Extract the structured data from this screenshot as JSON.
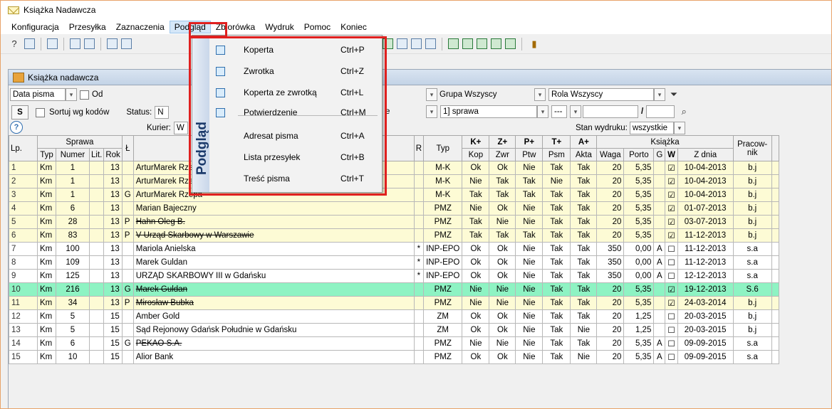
{
  "app": {
    "title": "Książka Nadawcza"
  },
  "menubar": [
    "Konfiguracja",
    "Przesyłka",
    "Zaznaczenia",
    "Podgląd",
    "Zbiorówka",
    "Wydruk",
    "Pomoc",
    "Koniec"
  ],
  "child_window": {
    "title": "Książka nadawcza"
  },
  "filters": {
    "date_field": "Data pisma",
    "od_label": "Od",
    "s_button": "S",
    "sort_label": "Sortuj wg kodów",
    "status_label": "Status:",
    "status_value": "N",
    "kurier_label": "Kurier:",
    "kurier_value": "W",
    "grupa": "Grupa  Wszyscy",
    "rola": "Rola  Wszyscy",
    "sprawa": "1] sprawa",
    "e_value": "e",
    "dash": "---",
    "slash": "/",
    "stan_label": "Stan wydruku:",
    "stan_value": "wszystkie"
  },
  "menu": {
    "side_label": "Podgląd",
    "items": [
      {
        "label": "Koperta",
        "shortcut": "Ctrl+P"
      },
      {
        "label": "Zwrotka",
        "shortcut": "Ctrl+Z"
      },
      {
        "label": "Koperta ze zwrotką",
        "shortcut": "Ctrl+L"
      },
      {
        "label": "Potwierdzenie",
        "shortcut": "Ctrl+M"
      },
      {
        "label": "Adresat pisma",
        "shortcut": "Ctrl+A"
      },
      {
        "label": "Lista przesyłek",
        "shortcut": "Ctrl+B"
      },
      {
        "label": "Treść pisma",
        "shortcut": "Ctrl+T"
      }
    ]
  },
  "grid": {
    "headers_top": {
      "lp": "Lp.",
      "sprawa": "Sprawa",
      "l": "Ł",
      "r": "R",
      "typ": "Typ",
      "k": "K+",
      "z": "Z+",
      "p": "P+",
      "t": "T+",
      "a": "A+",
      "ksiazka": "Książka",
      "prac1": "Pracow-",
      "prac2": "nik"
    },
    "headers_sub": {
      "typ": "Typ",
      "numer": "Numer",
      "lit": "Lit.",
      "rok": "Rok",
      "k": "Kop",
      "z": "Zwr",
      "p": "Ptw",
      "t": "Psm",
      "a": "Akta",
      "waga": "Waga",
      "porto": "Porto",
      "g": "G",
      "w": "W",
      "zdnia": "Z dnia"
    },
    "rows": [
      {
        "lp": "1",
        "typ": "Km",
        "numer": "1",
        "lit": "",
        "rok": "13",
        "l": "",
        "name": "ArturMarek Rzepa",
        "strike": false,
        "r": "",
        "typ2": "M-K",
        "k": "Ok",
        "z": "Ok",
        "p": "Nie",
        "t": "Tak",
        "a": "Tak",
        "waga": "20",
        "porto": "5,35",
        "g": "",
        "w": "☑",
        "zdnia": "10-04-2013",
        "prac": "b.j",
        "color": "y"
      },
      {
        "lp": "2",
        "typ": "Km",
        "numer": "1",
        "lit": "",
        "rok": "13",
        "l": "",
        "name": "ArturMarek Rzepa",
        "strike": false,
        "r": "",
        "typ2": "M-K",
        "k": "Nie",
        "z": "Tak",
        "p": "Tak",
        "t": "Nie",
        "a": "Tak",
        "waga": "20",
        "porto": "5,35",
        "g": "",
        "w": "☑",
        "zdnia": "10-04-2013",
        "prac": "b.j",
        "color": "y"
      },
      {
        "lp": "3",
        "typ": "Km",
        "numer": "1",
        "lit": "",
        "rok": "13",
        "l": "G",
        "name": "ArturMarek Rzepa",
        "strike": false,
        "r": "",
        "typ2": "M-K",
        "k": "Tak",
        "z": "Tak",
        "p": "Tak",
        "t": "Tak",
        "a": "Tak",
        "waga": "20",
        "porto": "5,35",
        "g": "",
        "w": "☑",
        "zdnia": "10-04-2013",
        "prac": "b.j",
        "color": "y"
      },
      {
        "lp": "4",
        "typ": "Km",
        "numer": "6",
        "lit": "",
        "rok": "13",
        "l": "",
        "name": "Marian Bajeczny",
        "strike": false,
        "r": "",
        "typ2": "PMZ",
        "k": "Nie",
        "z": "Ok",
        "p": "Nie",
        "t": "Tak",
        "a": "Tak",
        "waga": "20",
        "porto": "5,35",
        "g": "",
        "w": "☑",
        "zdnia": "01-07-2013",
        "prac": "b.j",
        "color": "y"
      },
      {
        "lp": "5",
        "typ": "Km",
        "numer": "28",
        "lit": "",
        "rok": "13",
        "l": "P",
        "name": "Hahn Oleg B.",
        "strike": true,
        "r": "",
        "typ2": "PMZ",
        "k": "Tak",
        "z": "Nie",
        "p": "Nie",
        "t": "Tak",
        "a": "Tak",
        "waga": "20",
        "porto": "5,35",
        "g": "",
        "w": "☑",
        "zdnia": "03-07-2013",
        "prac": "b.j",
        "color": "y"
      },
      {
        "lp": "6",
        "typ": "Km",
        "numer": "83",
        "lit": "",
        "rok": "13",
        "l": "P",
        "name": "V Urząd Skarbowy w Warszawie",
        "strike": true,
        "r": "",
        "typ2": "PMZ",
        "k": "Tak",
        "z": "Tak",
        "p": "Tak",
        "t": "Tak",
        "a": "Tak",
        "waga": "20",
        "porto": "5,35",
        "g": "",
        "w": "☑",
        "zdnia": "11-12-2013",
        "prac": "b.j",
        "color": "y"
      },
      {
        "lp": "7",
        "typ": "Km",
        "numer": "100",
        "lit": "",
        "rok": "13",
        "l": "",
        "name": "Mariola Anielska",
        "strike": false,
        "r": "*",
        "typ2": "INP-EPO",
        "k": "Ok",
        "z": "Ok",
        "p": "Nie",
        "t": "Tak",
        "a": "Tak",
        "waga": "350",
        "porto": "0,00",
        "g": "A",
        "w": "☐",
        "zdnia": "11-12-2013",
        "prac": "s.a",
        "color": "w"
      },
      {
        "lp": "8",
        "typ": "Km",
        "numer": "109",
        "lit": "",
        "rok": "13",
        "l": "",
        "name": "Marek Guldan",
        "strike": false,
        "r": "*",
        "typ2": "INP-EPO",
        "k": "Ok",
        "z": "Ok",
        "p": "Nie",
        "t": "Tak",
        "a": "Tak",
        "waga": "350",
        "porto": "0,00",
        "g": "A",
        "w": "☐",
        "zdnia": "11-12-2013",
        "prac": "s.a",
        "color": "w"
      },
      {
        "lp": "9",
        "typ": "Km",
        "numer": "125",
        "lit": "",
        "rok": "13",
        "l": "",
        "name": "URZĄD SKARBOWY III w Gdańsku",
        "strike": false,
        "r": "*",
        "typ2": "INP-EPO",
        "k": "Ok",
        "z": "Ok",
        "p": "Nie",
        "t": "Tak",
        "a": "Tak",
        "waga": "350",
        "porto": "0,00",
        "g": "A",
        "w": "☐",
        "zdnia": "12-12-2013",
        "prac": "s.a",
        "color": "w"
      },
      {
        "lp": "10",
        "typ": "Km",
        "numer": "216",
        "lit": "",
        "rok": "13",
        "l": "G",
        "name": "Marek Guldan",
        "strike": true,
        "r": "",
        "typ2": "PMZ",
        "k": "Nie",
        "z": "Nie",
        "p": "Nie",
        "t": "Tak",
        "a": "Tak",
        "waga": "20",
        "porto": "5,35",
        "g": "",
        "w": "☑",
        "zdnia": "19-12-2013",
        "prac": "S.6",
        "color": "g"
      },
      {
        "lp": "11",
        "typ": "Km",
        "numer": "34",
        "lit": "",
        "rok": "13",
        "l": "P",
        "name": "Mirosław Bubka",
        "strike": true,
        "r": "",
        "typ2": "PMZ",
        "k": "Nie",
        "z": "Nie",
        "p": "Nie",
        "t": "Tak",
        "a": "Tak",
        "waga": "20",
        "porto": "5,35",
        "g": "",
        "w": "☑",
        "zdnia": "24-03-2014",
        "prac": "b.j",
        "color": "y"
      },
      {
        "lp": "12",
        "typ": "Km",
        "numer": "5",
        "lit": "",
        "rok": "15",
        "l": "",
        "name": "Amber Gold",
        "strike": false,
        "r": "",
        "typ2": "ZM",
        "k": "Ok",
        "z": "Ok",
        "p": "Nie",
        "t": "Tak",
        "a": "Tak",
        "waga": "20",
        "porto": "1,25",
        "g": "",
        "w": "☐",
        "zdnia": "20-03-2015",
        "prac": "b.j",
        "color": "w"
      },
      {
        "lp": "13",
        "typ": "Km",
        "numer": "5",
        "lit": "",
        "rok": "15",
        "l": "",
        "name": "Sąd Rejonowy Gdańsk Południe w Gdańsku",
        "strike": false,
        "r": "",
        "typ2": "ZM",
        "k": "Ok",
        "z": "Ok",
        "p": "Nie",
        "t": "Tak",
        "a": "Nie",
        "waga": "20",
        "porto": "1,25",
        "g": "",
        "w": "☐",
        "zdnia": "20-03-2015",
        "prac": "b.j",
        "color": "w"
      },
      {
        "lp": "14",
        "typ": "Km",
        "numer": "6",
        "lit": "",
        "rok": "15",
        "l": "G",
        "name": "PEKAO S.A.",
        "strike": true,
        "r": "",
        "typ2": "PMZ",
        "k": "Nie",
        "z": "Nie",
        "p": "Nie",
        "t": "Tak",
        "a": "Tak",
        "waga": "20",
        "porto": "5,35",
        "g": "A",
        "w": "☐",
        "zdnia": "09-09-2015",
        "prac": "s.a",
        "color": "w"
      },
      {
        "lp": "15",
        "typ": "Km",
        "numer": "10",
        "lit": "",
        "rok": "15",
        "l": "",
        "name": "Alior Bank",
        "strike": false,
        "r": "",
        "typ2": "PMZ",
        "k": "Ok",
        "z": "Ok",
        "p": "Nie",
        "t": "Tak",
        "a": "Nie",
        "waga": "20",
        "porto": "5,35",
        "g": "A",
        "w": "☐",
        "zdnia": "09-09-2015",
        "prac": "s.a",
        "color": "w"
      }
    ]
  }
}
